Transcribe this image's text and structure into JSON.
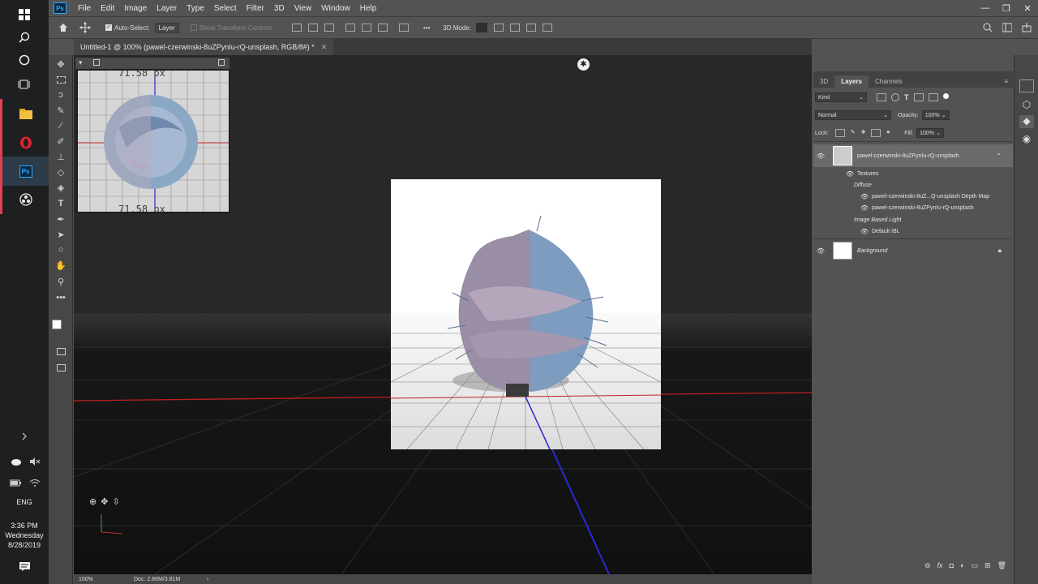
{
  "taskbar": {
    "time": "3:36 PM",
    "day": "Wednesday",
    "date": "8/28/2019",
    "language": "ENG"
  },
  "menubar": {
    "app": "Ps",
    "items": [
      "File",
      "Edit",
      "Image",
      "Layer",
      "Type",
      "Select",
      "Filter",
      "3D",
      "View",
      "Window",
      "Help"
    ]
  },
  "options": {
    "auto_select_label": "Auto-Select:",
    "auto_select_value": "Layer",
    "show_transform_label": "Show Transform Controls",
    "mode_label": "3D Mode:"
  },
  "document": {
    "tab_title": "Untitled-1 @ 100% (pawel-czerwinski-8uZPynIu-rQ-unsplash, RGB/8#) *",
    "thumb_label": "71.58 px",
    "zoom": "100%",
    "doc_size": "Doc: 2.86M/3.81M"
  },
  "panel": {
    "tabs": [
      "3D",
      "Layers",
      "Channels"
    ],
    "active_tab": "Layers",
    "filter_kind": "Kind",
    "blend_mode": "Normal",
    "opacity_label": "Opacity:",
    "opacity_value": "100%",
    "lock_label": "Lock:",
    "fill_label": "Fill:",
    "fill_value": "100%",
    "layers": {
      "main": "pawel-czerwinski-8uZPynIu-rQ-unsplash",
      "textures": "Textures",
      "diffuse": "Diffuse",
      "depth_map": "pawel-czerwinski-8uZ...Q-unsplash Depth Map",
      "diffuse_tex": "pawel-czerwinski-8uZPynIu-rQ-unsplash",
      "ibl": "Image Based Light",
      "default_ibl": "Default IBL",
      "background": "Background"
    }
  },
  "colors": {
    "accent": "#31a8ff",
    "opera_red": "#e3212f",
    "taskbar_bg": "#1d1f21"
  }
}
